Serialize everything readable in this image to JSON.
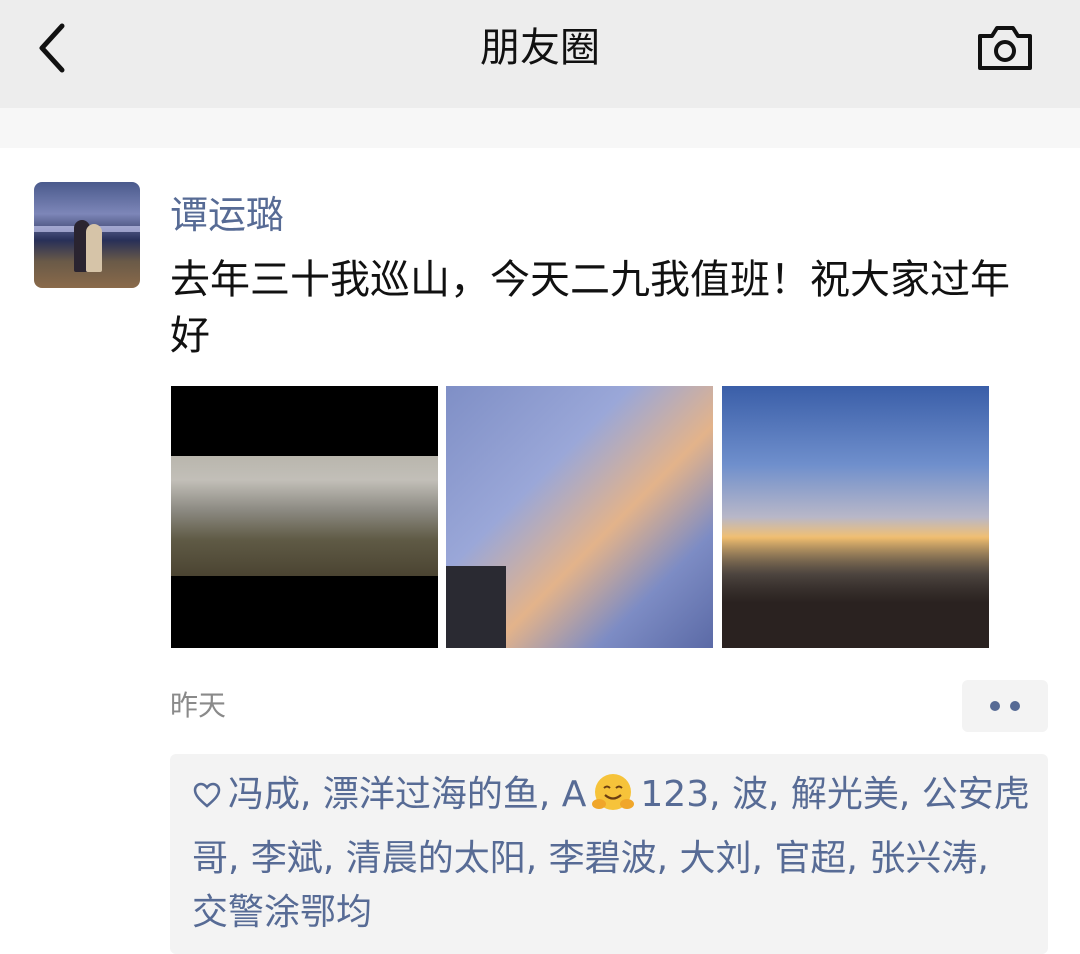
{
  "header": {
    "title": "朋友圈",
    "back_icon": "chevron-left-icon",
    "camera_icon": "camera-icon"
  },
  "post": {
    "author": "谭运璐",
    "text": "去年三十我巡山，今天二九我值班！祝大家过年好",
    "photos": [
      {
        "name": "photo-mountains"
      },
      {
        "name": "photo-sky-clouds"
      },
      {
        "name": "photo-sunrise-pavilion"
      }
    ],
    "time": "昨天",
    "more_icon": "more-dots-icon",
    "likes": {
      "icon": "heart-icon",
      "before_emoji": "冯成, 漂洋过海的鱼, A",
      "emoji_icon": "hugging-face-emoji-icon",
      "after_emoji": "123, 波, 解光美, 公安虎哥, 李斌, 清晨的太阳, 李碧波, 大刘, 官超, 张兴涛, 交警涂鄂均"
    }
  },
  "colors": {
    "link": "#576b95",
    "header_bg": "#ededed",
    "likes_bg": "#f3f3f3"
  }
}
